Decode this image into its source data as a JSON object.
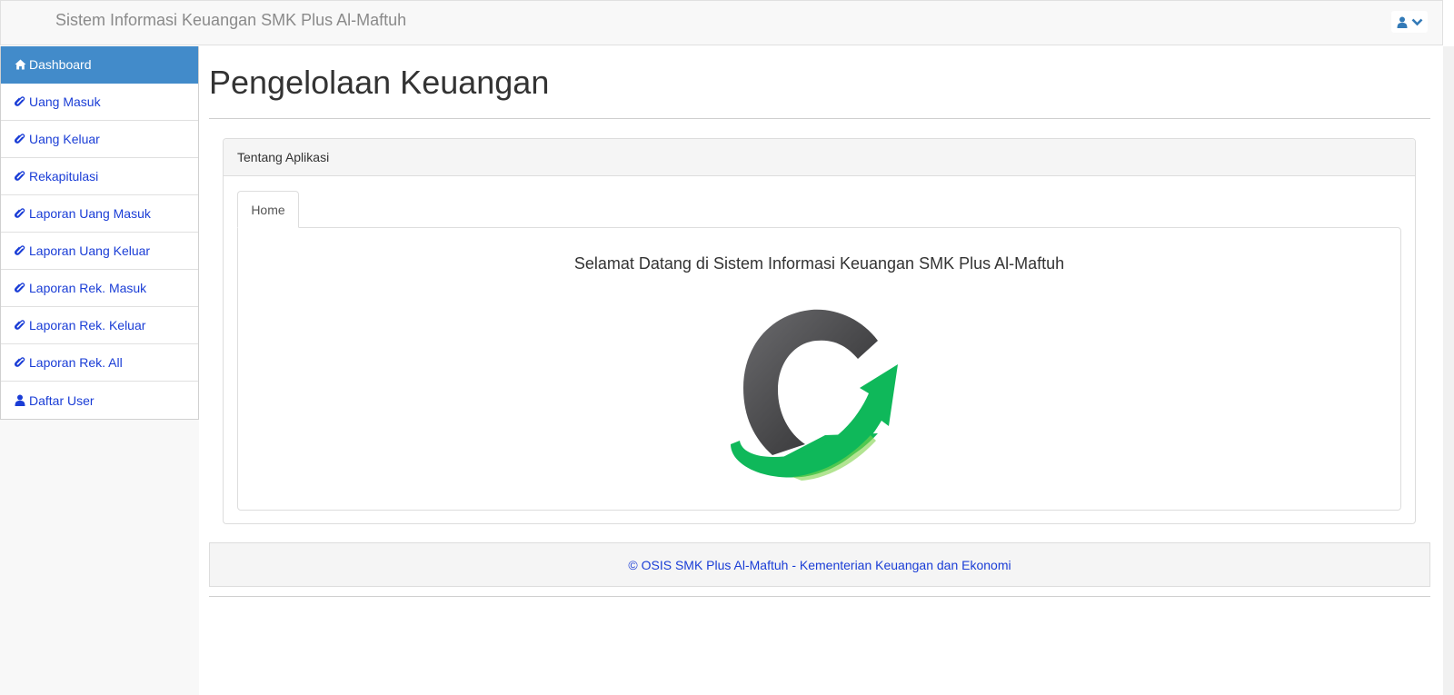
{
  "header": {
    "brand": "Sistem Informasi Keuangan SMK Plus Al-Maftuh",
    "user_icon": "user-icon",
    "dropdown_icon": "chevron-down-icon"
  },
  "sidebar": {
    "items": [
      {
        "label": "Dashboard",
        "icon": "home-icon",
        "active": true
      },
      {
        "label": "Uang Masuk",
        "icon": "paperclip-icon"
      },
      {
        "label": "Uang Keluar",
        "icon": "paperclip-icon"
      },
      {
        "label": "Rekapitulasi",
        "icon": "paperclip-icon"
      },
      {
        "label": "Laporan Uang Masuk",
        "icon": "paperclip-icon"
      },
      {
        "label": "Laporan Uang Keluar",
        "icon": "paperclip-icon"
      },
      {
        "label": "Laporan Rek. Masuk",
        "icon": "paperclip-icon"
      },
      {
        "label": "Laporan Rek. Keluar",
        "icon": "paperclip-icon"
      },
      {
        "label": "Laporan Rek. All",
        "icon": "paperclip-icon"
      },
      {
        "label": "Daftar User",
        "icon": "user-icon"
      }
    ]
  },
  "main": {
    "title": "Pengelolaan Keuangan",
    "panel": {
      "heading": "Tentang Aplikasi",
      "tabs": [
        {
          "label": "Home"
        }
      ],
      "welcome": "Selamat Datang di Sistem Informasi Keuangan SMK Plus Al-Maftuh"
    }
  },
  "footer": {
    "text": "© OSIS SMK Plus Al-Maftuh - Kementerian Keuangan dan Ekonomi"
  },
  "colors": {
    "accent": "#428bca",
    "link": "#1a3dd6",
    "logo_dark": "#4a4a4c",
    "logo_green": "#0fb85a"
  }
}
